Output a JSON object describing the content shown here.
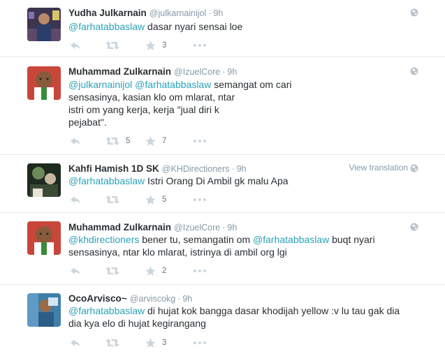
{
  "tweets": [
    {
      "name": "Yudha Julkarnain",
      "handle": "@julkarnainijol",
      "time": "9h",
      "mention": "@farhatabbaslaw",
      "text": " dasar nyari sensai loe",
      "retweets": "",
      "favorites": "3"
    },
    {
      "name": "Muhammad Zulkarnain",
      "handle": "@IzuelCore",
      "time": "9h",
      "mention": "@julkarnainijol",
      "mention2": "@farhatabbaslaw",
      "text_line1": " semangat om cari",
      "text_line2": "sensasinya, kasian klo om mlarat, ntar",
      "text_line3": "istri om yang kerja, kerja \"jual diri k",
      "text_line4": "pejabat\".",
      "retweets": "5",
      "favorites": "7"
    },
    {
      "name": "Kahfi Hamish 1D SK",
      "handle": "@KHDirectioners",
      "time": "9h",
      "view_translation": "View translation",
      "mention": "@farhatabbaslaw",
      "text": " Istri Orang Di Ambil gk malu Apa",
      "retweets": "",
      "favorites": "5"
    },
    {
      "name": "Muhammad Zulkarnain",
      "handle": "@IzuelCore",
      "time": "9h",
      "mention": "@khdirectioners",
      "text_a": " bener tu, semangatin om ",
      "mention2": "@farhatabbaslaw",
      "text_b": " buqt nyari",
      "text_line2": "sensasinya, ntar klo mlarat, istrinya di ambil org lgi",
      "retweets": "",
      "favorites": "2"
    },
    {
      "name": "OcoArvisco~",
      "handle": "@arviscokg",
      "time": "9h",
      "mention": "@farhatabbaslaw",
      "text_a": " di hujat kok bangga dasar khodijah yellow :v lu tau gak dia",
      "text_line2": "dia kya elo di hujat kegirangang",
      "retweets": "",
      "favorites": "3"
    }
  ],
  "colors": {
    "mention": "#2aa3b8",
    "name": "#292f33",
    "meta": "#8899a6",
    "icon": "#ccd6dd",
    "divider": "#e1e8ed"
  },
  "icons": [
    "reply-icon",
    "retweet-icon",
    "favorite-icon",
    "more-icon",
    "globe-icon"
  ]
}
